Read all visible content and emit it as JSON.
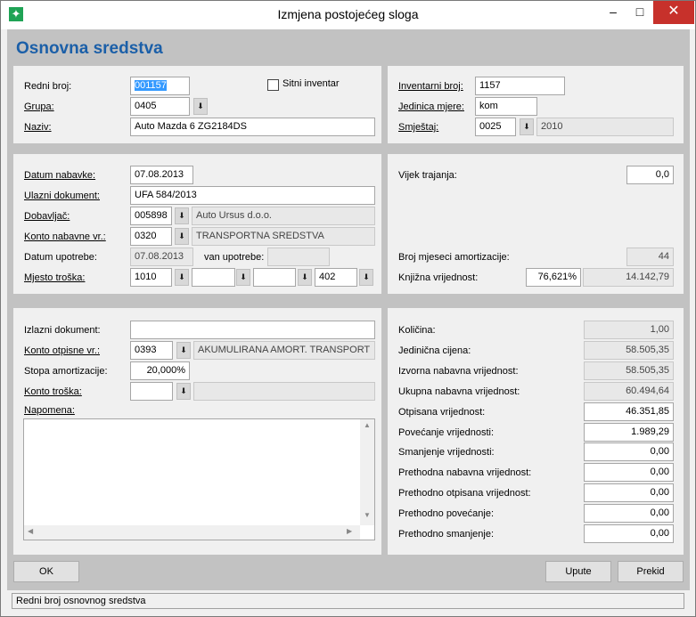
{
  "window": {
    "title": "Izmjena postojećeg sloga",
    "minimize": "–",
    "maximize": "□",
    "close": "✕",
    "app_icon_glyph": "✦"
  },
  "form": {
    "heading": "Osnovna sredstva"
  },
  "general": {
    "redni_broj_label": "Redni broj:",
    "redni_broj_value": "001157",
    "sitni_inventar_label": "Sitni inventar",
    "sitni_inventar_checked": false,
    "grupa_label": "Grupa:",
    "grupa_value": "0405",
    "naziv_label": "Naziv:",
    "naziv_value": "Auto Mazda 6 ZG2184DS",
    "inventarni_broj_label": "Inventarni broj:",
    "inventarni_broj_value": "1157",
    "jedinica_mjere_label": "Jedinica mjere:",
    "jedinica_mjere_value": "kom",
    "smjestaj_label": "Smještaj:",
    "smjestaj_code": "0025",
    "smjestaj_name": "2010"
  },
  "acquisition": {
    "datum_nabavke_label": "Datum nabavke:",
    "datum_nabavke_value": "07.08.2013",
    "ulazni_dokument_label": "Ulazni dokument:",
    "ulazni_dokument_value": "UFA 584/2013",
    "dobavljac_label": "Dobavljač:",
    "dobavljac_code": "005898",
    "dobavljac_name": "Auto Ursus d.o.o.",
    "konto_nabavne_label": "Konto nabavne vr.:",
    "konto_nabavne_code": "0320",
    "konto_nabavne_name": "TRANSPORTNA SREDSTVA",
    "datum_upotrebe_label": "Datum upotrebe:",
    "datum_upotrebe_value": "07.08.2013",
    "van_upotrebe_label": "van upotrebe:",
    "van_upotrebe_value": "",
    "mjesto_troska_label": "Mjesto troška:",
    "mjesto_troska_1": "1010",
    "mjesto_troska_2": "",
    "mjesto_troska_3": "",
    "mjesto_troska_4": "402",
    "vijek_trajanja_label": "Vijek trajanja:",
    "vijek_trajanja_value": "0,0",
    "broj_mjeseci_label": "Broj mjeseci amortizacije:",
    "broj_mjeseci_value": "44",
    "knjizna_label": "Knjižna vrijednost:",
    "knjizna_pct": "76,621%",
    "knjizna_value": "14.142,79"
  },
  "disposal": {
    "izlazni_dokument_label": "Izlazni dokument:",
    "izlazni_dokument_value": "",
    "konto_otpisne_label": "Konto otpisne vr.:",
    "konto_otpisne_code": "0393",
    "konto_otpisne_name": "AKUMULIRANA AMORT.  TRANSPORT",
    "stopa_label": "Stopa amortizacije:",
    "stopa_value": "20,000%",
    "konto_troska_label": "Konto troška:",
    "konto_troska_code": "",
    "konto_troska_name": "",
    "napomena_label": "Napomena:",
    "napomena_value": ""
  },
  "values": [
    {
      "label": "Količina:",
      "value": "1,00",
      "readonly": true
    },
    {
      "label": "Jedinična cijena:",
      "value": "58.505,35",
      "readonly": true
    },
    {
      "label": "Izvorna nabavna vrijednost:",
      "value": "58.505,35",
      "readonly": true
    },
    {
      "label": "Ukupna nabavna vrijednost:",
      "value": "60.494,64",
      "readonly": true
    },
    {
      "label": "Otpisana vrijednost:",
      "value": "46.351,85",
      "readonly": false
    },
    {
      "label": "Povećanje vrijednosti:",
      "value": "1.989,29",
      "readonly": false
    },
    {
      "label": "Smanjenje vrijednosti:",
      "value": "0,00",
      "readonly": false
    },
    {
      "label": "Prethodna nabavna vrijednost:",
      "value": "0,00",
      "readonly": false
    },
    {
      "label": "Prethodno otpisana vrijednost:",
      "value": "0,00",
      "readonly": false
    },
    {
      "label": "Prethodno povećanje:",
      "value": "0,00",
      "readonly": false
    },
    {
      "label": "Prethodno smanjenje:",
      "value": "0,00",
      "readonly": false
    }
  ],
  "buttons": {
    "ok": "OK",
    "upute": "Upute",
    "prekid": "Prekid"
  },
  "icons": {
    "dropdown": "⬇",
    "scroll_up": "▲",
    "scroll_down": "▼",
    "scroll_left": "◀",
    "scroll_right": "▶"
  },
  "status": {
    "text": "Redni broj osnovnog sredstva"
  }
}
